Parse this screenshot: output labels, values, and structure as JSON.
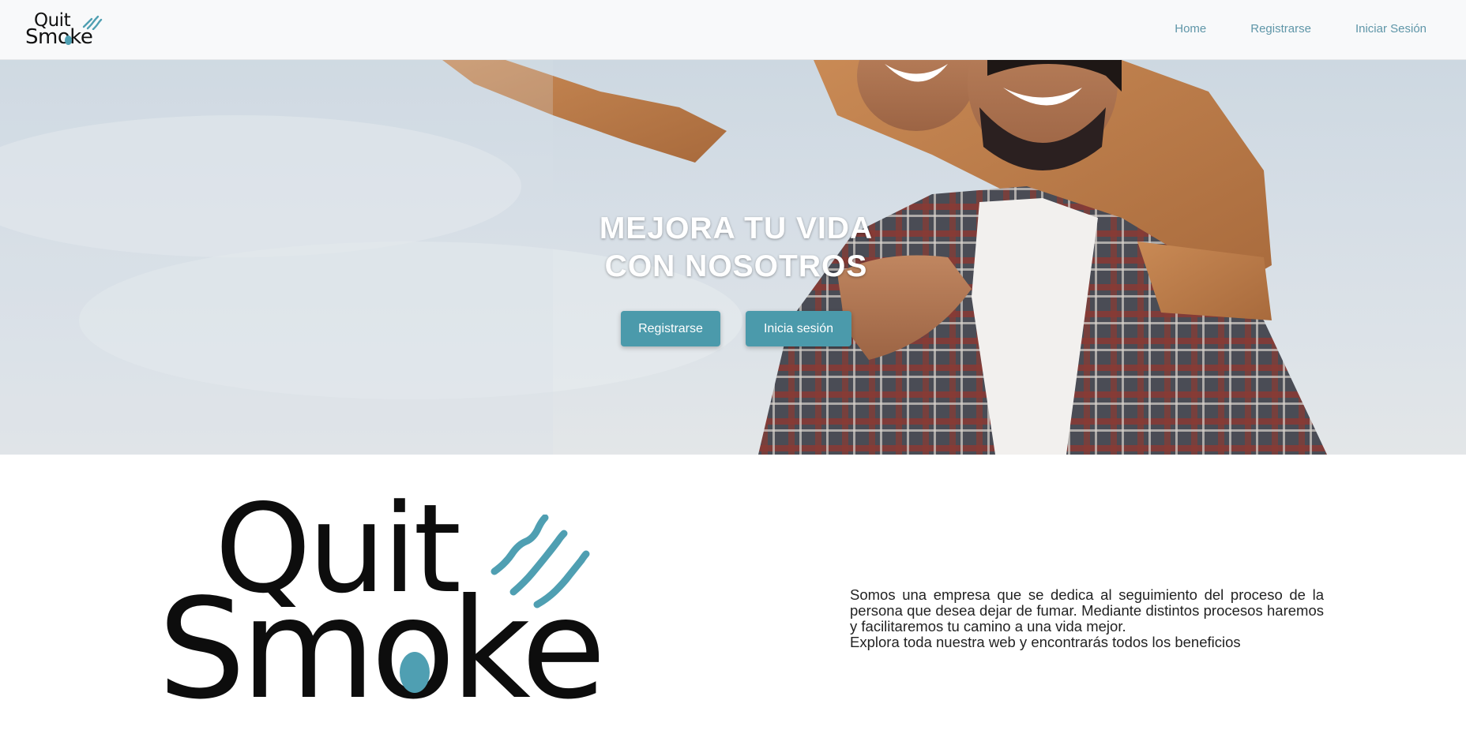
{
  "navbar": {
    "brand": {
      "line1": "Quit",
      "line2": "Smoke"
    },
    "links": [
      {
        "label": "Home"
      },
      {
        "label": "Registrarse"
      },
      {
        "label": "Iniciar Sesión"
      }
    ]
  },
  "hero": {
    "title_line1": "MEJORA TU VIDA",
    "title_line2": "CON NOSOTROS",
    "register_button": "Registrarse",
    "login_button": "Inicia sesión"
  },
  "about": {
    "logo": {
      "line1": "Quit",
      "line2": "Smoke"
    },
    "paragraph": "Somos una empresa que se dedica al seguimiento del proceso de la persona que desea dejar de fumar. Mediante distintos procesos haremos y facilitaremos tu camino a una vida mejor.",
    "paragraph2": "Explora toda nuestra web y encontrarás todos los beneficios"
  },
  "colors": {
    "accent": "#4b9aab",
    "nav_link": "#5f96a8",
    "navbar_bg": "#f8f9fa"
  }
}
